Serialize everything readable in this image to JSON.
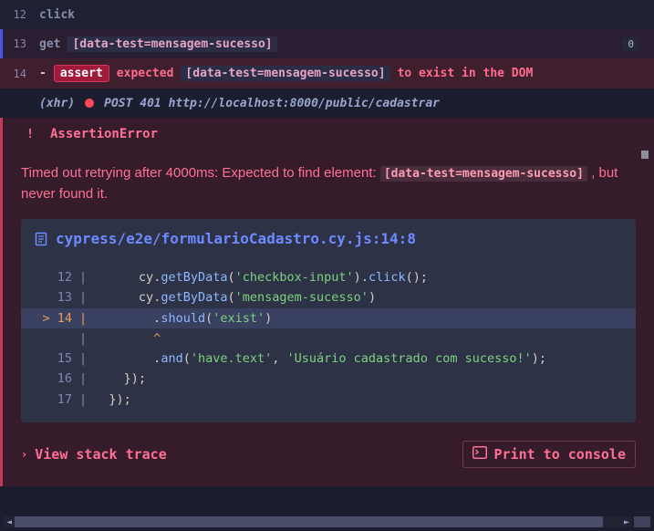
{
  "log": {
    "lines": [
      {
        "num": "12",
        "type": "click",
        "cmd": "click"
      },
      {
        "num": "13",
        "type": "get",
        "cmd": "get",
        "selector": "[data-test=mensagem-sucesso]",
        "badge": "0"
      },
      {
        "num": "14",
        "type": "assert",
        "dash": "-",
        "assert_label": "assert",
        "expected": "expected",
        "selector": "[data-test=mensagem-sucesso]",
        "tail": "to exist in the DOM"
      }
    ],
    "xhr": {
      "label": "(xhr)",
      "method": "POST 401 http://localhost:8000/public/cadastrar"
    }
  },
  "error": {
    "icon": "!",
    "title": "AssertionError",
    "msg_prefix": "Timed out retrying after 4000ms: Expected to find element: ",
    "msg_code": "[data-test=mensagem-sucesso]",
    "msg_suffix": " , but never found it.",
    "file_path": "cypress/e2e/formularioCadastro.cy.js:14:8"
  },
  "code": {
    "rows": [
      {
        "n": "12",
        "hl": false,
        "pre": "      ",
        "segs": [
          [
            "obj",
            "cy"
          ],
          [
            "dot",
            "."
          ],
          [
            "method",
            "getByData"
          ],
          [
            "paren",
            "("
          ],
          [
            "str",
            "'checkbox-input'"
          ],
          [
            "paren",
            ")"
          ],
          [
            "dot",
            "."
          ],
          [
            "method",
            "click"
          ],
          [
            "paren",
            "()"
          ],
          [
            "punc",
            ";"
          ]
        ]
      },
      {
        "n": "13",
        "hl": false,
        "pre": "      ",
        "segs": [
          [
            "obj",
            "cy"
          ],
          [
            "dot",
            "."
          ],
          [
            "method",
            "getByData"
          ],
          [
            "paren",
            "("
          ],
          [
            "str",
            "'mensagem-sucesso'"
          ],
          [
            "paren",
            ")"
          ]
        ]
      },
      {
        "n": "> 14",
        "hl": true,
        "pre": "        ",
        "segs": [
          [
            "dot",
            "."
          ],
          [
            "method",
            "should"
          ],
          [
            "paren",
            "("
          ],
          [
            "str",
            "'exist'"
          ],
          [
            "paren",
            ")"
          ]
        ]
      },
      {
        "n": "",
        "hl": false,
        "pre": "        ",
        "segs": [
          [
            "caret",
            "^"
          ]
        ]
      },
      {
        "n": "15",
        "hl": false,
        "pre": "        ",
        "segs": [
          [
            "dot",
            "."
          ],
          [
            "method",
            "and"
          ],
          [
            "paren",
            "("
          ],
          [
            "str",
            "'have.text'"
          ],
          [
            "punc",
            ", "
          ],
          [
            "str",
            "'Usuário cadastrado com sucesso!'"
          ],
          [
            "paren",
            ")"
          ],
          [
            "punc",
            ";"
          ]
        ]
      },
      {
        "n": "16",
        "hl": false,
        "pre": "    ",
        "segs": [
          [
            "punc",
            "});"
          ]
        ]
      },
      {
        "n": "17",
        "hl": false,
        "pre": "  ",
        "segs": [
          [
            "punc",
            "});"
          ]
        ]
      }
    ]
  },
  "actions": {
    "view_stack": "View stack trace",
    "print_console": "Print to console"
  }
}
